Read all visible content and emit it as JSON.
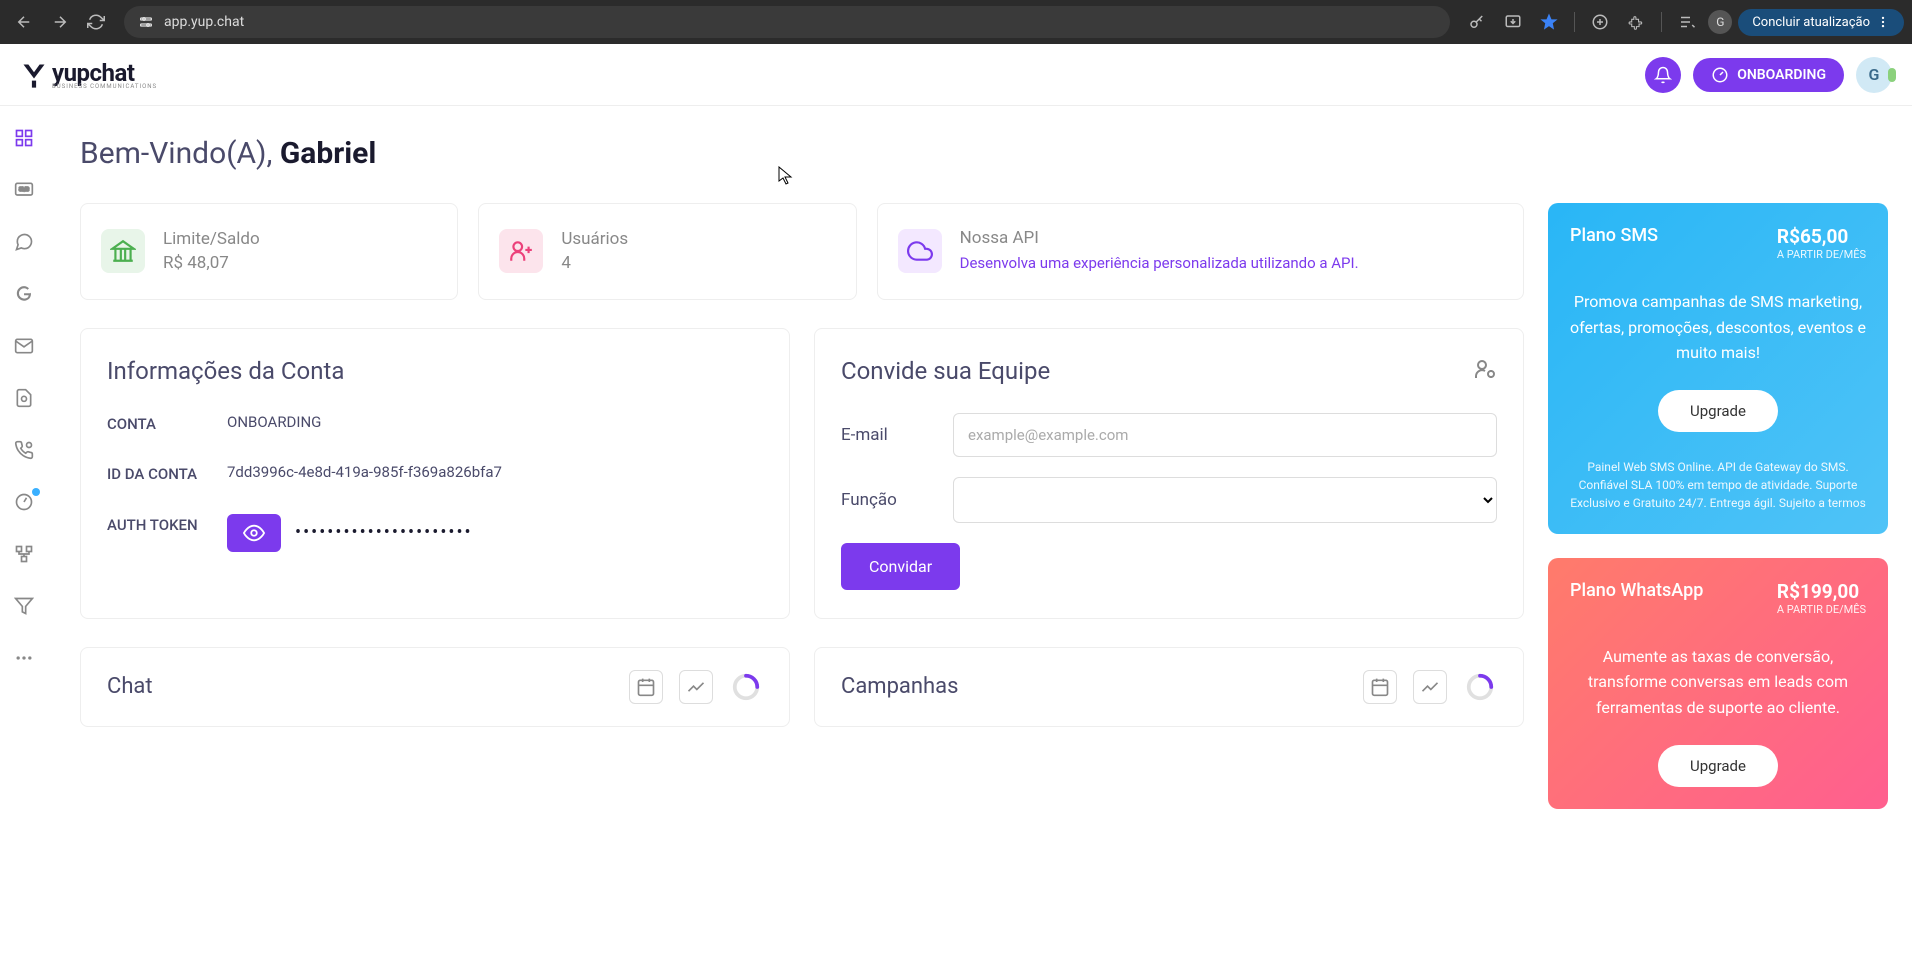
{
  "browser": {
    "url": "app.yup.chat",
    "avatar": "G",
    "update_label": "Concluir atualização"
  },
  "header": {
    "logo": "yupchat",
    "logo_sub": "BUSINESS COMMUNICATIONS",
    "onboarding_label": "ONBOARDING",
    "user_initial": "G"
  },
  "welcome": {
    "greeting": "Bem-Vindo(A), ",
    "name": "Gabriel"
  },
  "stats": {
    "balance_label": "Limite/Saldo",
    "balance_value": "R$ 48,07",
    "users_label": "Usuários",
    "users_value": "4",
    "api_title": "Nossa API",
    "api_desc": "Desenvolva uma experiência personalizada utilizando a API."
  },
  "account": {
    "title": "Informações da Conta",
    "account_label": "CONTA",
    "account_value": "ONBOARDING",
    "id_label": "ID DA CONTA",
    "id_value": "7dd3996c-4e8d-419a-985f-f369a826bfa7",
    "token_label": "AUTH TOKEN",
    "token_value": "••••••••••••••••••••••"
  },
  "invite": {
    "title": "Convide sua Equipe",
    "email_label": "E-mail",
    "email_placeholder": "example@example.com",
    "role_label": "Função",
    "button": "Convidar"
  },
  "bottom": {
    "chat_title": "Chat",
    "campaigns_title": "Campanhas"
  },
  "plans": {
    "sms": {
      "name": "Plano SMS",
      "price": "R$65,00",
      "sub": "A PARTIR DE/MÊS",
      "desc": "Promova campanhas de SMS marketing, ofertas, promoções, descontos, eventos e muito mais!",
      "button": "Upgrade",
      "fine": "Painel Web SMS Online. API de Gateway do SMS. Confiável SLA 100% em tempo de atividade. Suporte Exclusivo e Gratuito 24/7. Entrega ágil. Sujeito a termos"
    },
    "wa": {
      "name": "Plano WhatsApp",
      "price": "R$199,00",
      "sub": "A PARTIR DE/MÊS",
      "desc": "Aumente as taxas de conversão, transforme conversas em leads com ferramentas de suporte ao cliente.",
      "button": "Upgrade"
    }
  }
}
